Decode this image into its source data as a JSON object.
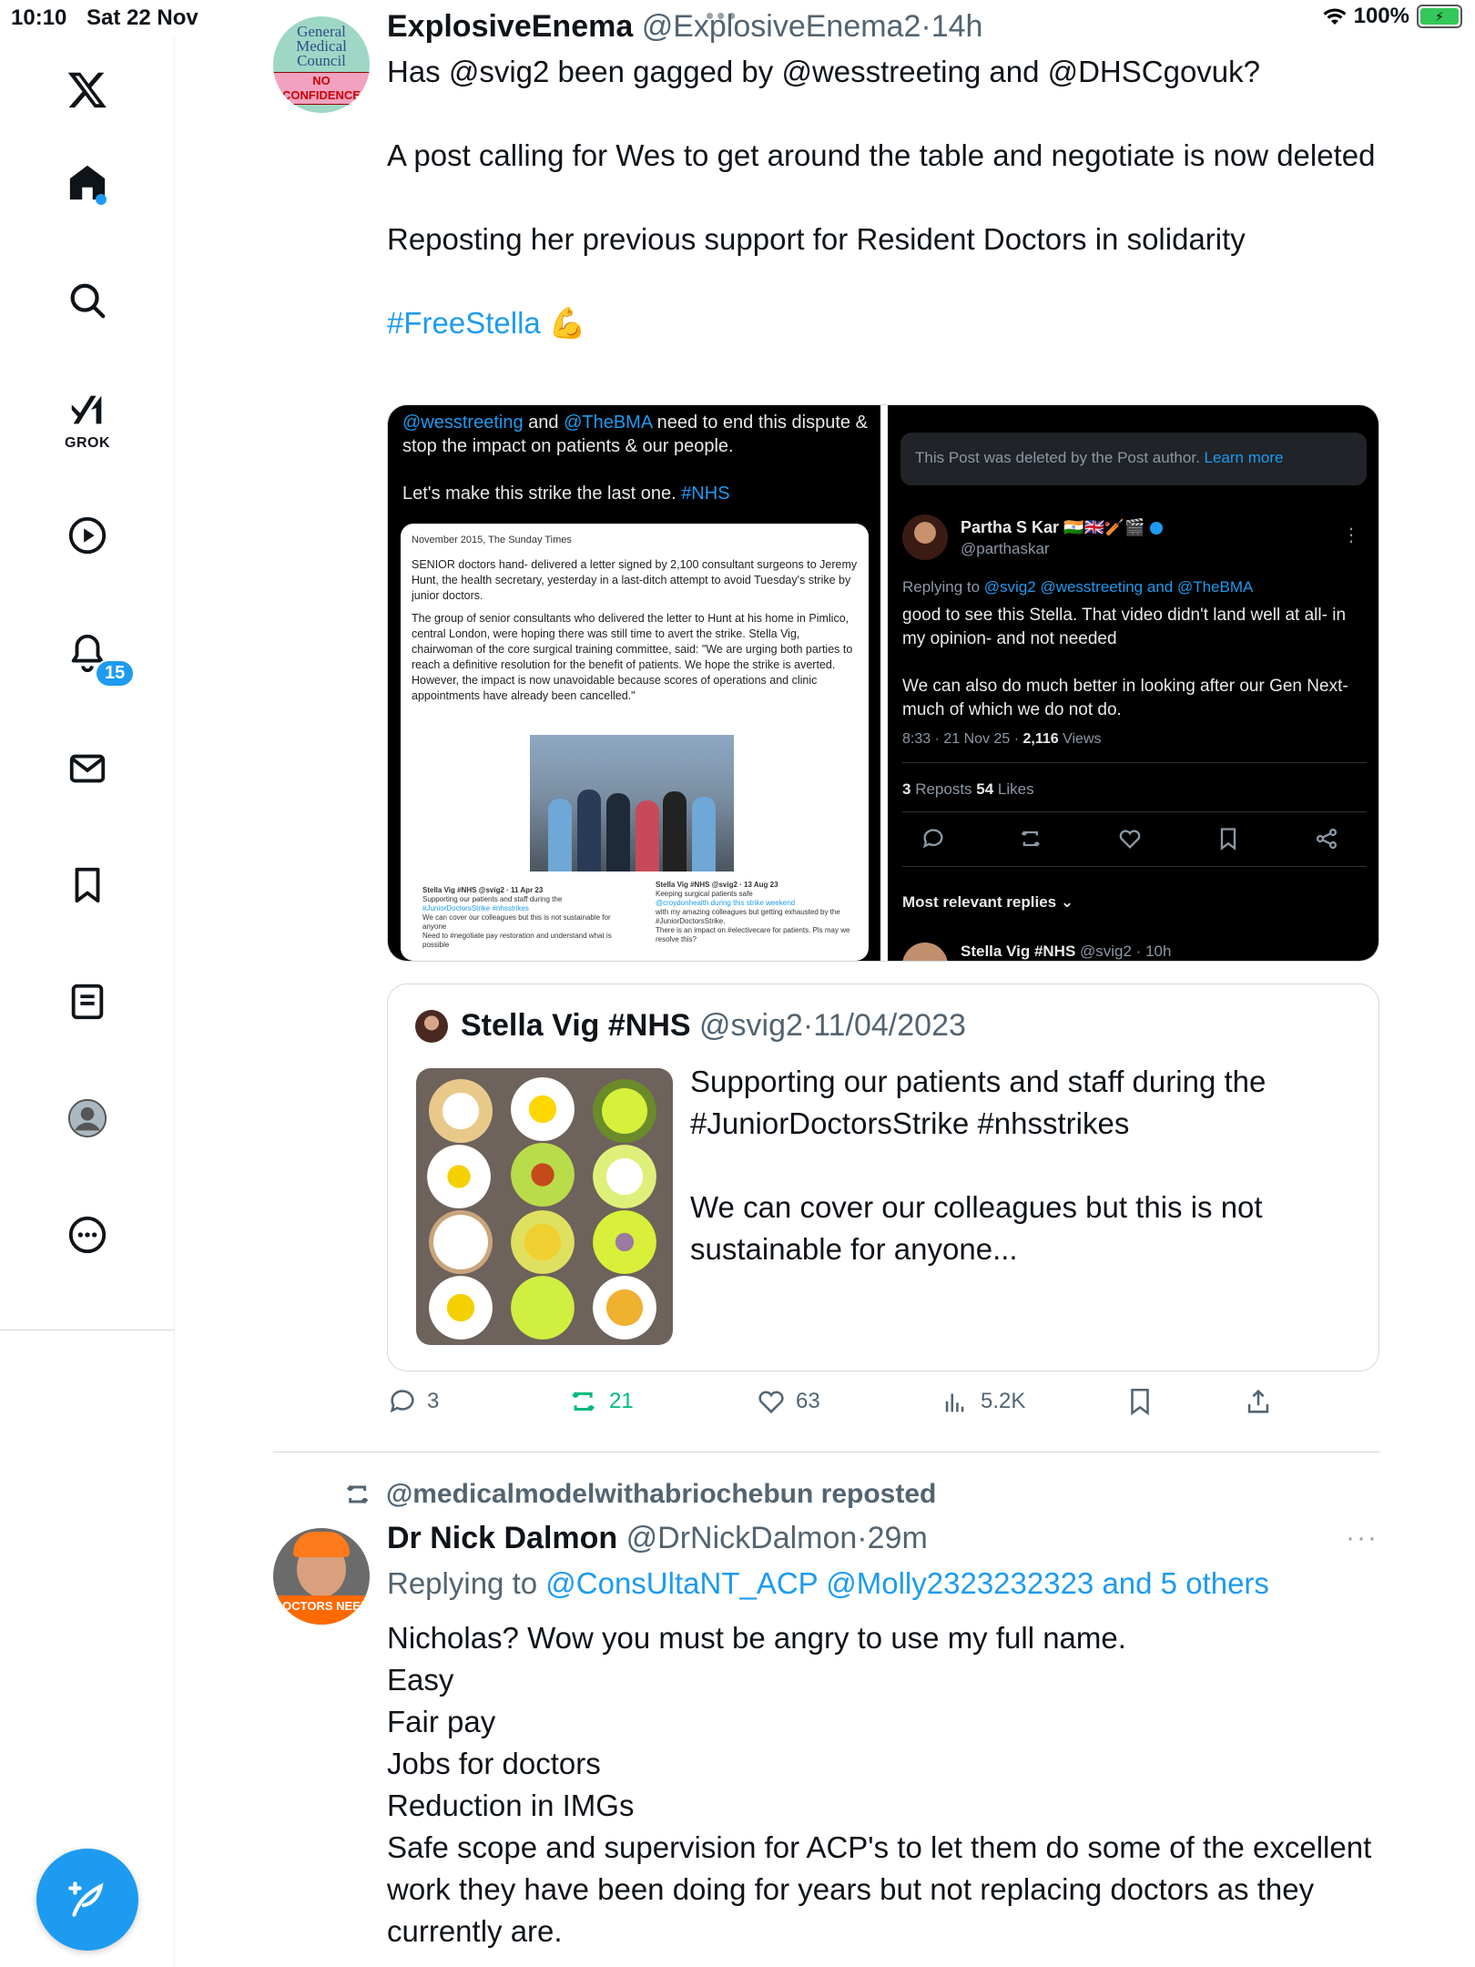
{
  "status_bar": {
    "time": "10:10",
    "date": "Sat 22 Nov",
    "battery": "100%"
  },
  "sidebar": {
    "items": [
      {
        "name": "x-logo-icon"
      },
      {
        "name": "home-icon"
      },
      {
        "name": "search-icon"
      },
      {
        "name": "grok-icon",
        "label": "GROK"
      },
      {
        "name": "video-icon"
      },
      {
        "name": "notifications-icon",
        "badge": "15"
      },
      {
        "name": "messages-icon"
      },
      {
        "name": "bookmarks-icon"
      },
      {
        "name": "lists-icon"
      },
      {
        "name": "profile-icon"
      },
      {
        "name": "more-icon"
      }
    ],
    "compose_icon": "compose-icon",
    "accent": "#1d9bf0"
  },
  "tweet1": {
    "avatar_text": [
      "General",
      "Medical",
      "Council"
    ],
    "avatar_badge": "NO CONFIDENCE",
    "name": "ExplosiveEnema",
    "handle": "@ExplosiveEnema2",
    "sep": "·",
    "time": "14h",
    "body": "Has @svig2 been gagged by @wesstreeting and @DHSCgovuk?\n\nA post calling for Wes to get around the table and negotiate is now deleted\n\nReposting her previous support for Resident Doctors in solidarity\n\n",
    "hashtag": "#FreeStella 💪",
    "media_left": {
      "line1_a": "@wesstreeting",
      "line1_b": " and ",
      "line1_c": "@TheBMA",
      "line1_d": "  need to end this dispute & stop the impact on patients & our people.",
      "line2_a": "Let's make this strike the last one. ",
      "line2_b": "#NHS",
      "article_source": "November 2015, The Sunday Times",
      "article_p1": "SENIOR doctors hand- delivered a letter signed by 2,100 consultant surgeons to Jeremy Hunt, the health secretary, yesterday in a last-ditch attempt to avoid Tuesday's strike by junior doctors.",
      "article_p2": "The group of senior consultants who delivered the letter to Hunt at his home in Pimlico, central London, were hoping there was still time to avert the strike. Stella Vig, chairwoman of the core surgical training committee, said: \"We are urging both parties to reach a definitive resolution for the benefit of patients. We hope the strike is averted. However, the impact is now unavoidable because scores of operations and clinic appointments have already been cancelled.\"",
      "mini1_head": "Stella Vig #NHS @svig2 · 11 Apr 23",
      "mini1_l1": "Supporting our patients and staff during the",
      "mini1_l2": "#JuniorDoctorsStrike #nhsstrikes",
      "mini1_l3": "We can cover our colleagues but this is not sustainable for anyone",
      "mini1_l4": "Need to #negotiate pay restoration and understand what is possible",
      "mini2_head": "Stella Vig #NHS @svig2 · 13 Aug 23",
      "mini2_l1": "Keeping surgical patients safe",
      "mini2_l2": "@croydonhealth during this strike weekend",
      "mini2_l3": "with my amazing colleagues but getting exhausted by the #JuniorDoctorsStrike.",
      "mini2_l4": "There is an impact on #electivecare for patients. Pls may we resolve this?"
    },
    "media_right": {
      "deleted_text": "This Post was deleted by the Post author. ",
      "learn_more": "Learn more",
      "name": "Partha S Kar 🇮🇳🇬🇧🏏🎬",
      "handle": "@parthaskar",
      "replying_a": "Replying to ",
      "replying_b": "@svig2 @wesstreeting and @TheBMA",
      "body": "good to see this Stella. That video didn't land well at all- in my opinion- and not needed\n\nWe can also do much better in looking after our Gen Next- much of which we do not do.",
      "meta_time": "8:33 · 21 Nov 25 · ",
      "meta_views": "2,116",
      "meta_views_label": " Views",
      "reposts": "3",
      "reposts_label": " Reposts   ",
      "likes": "54",
      "likes_label": " Likes",
      "relevant": "Most relevant replies  ⌄",
      "stella_name": "Stella Vig #NHS ",
      "stella_meta": "@svig2 · 10h"
    }
  },
  "quote": {
    "name": "Stella Vig #NHS",
    "handle": "@svig2",
    "sep": "·",
    "time": "11/04/2023",
    "body": "Supporting our patients and staff during the #JuniorDoctorsStrike #nhsstrikes\n\nWe can cover our colleagues but this is not sustainable for anyone..."
  },
  "actions": {
    "replies": "3",
    "reposts": "21",
    "likes": "63",
    "views": "5.2K"
  },
  "tweet2": {
    "reposted_by": "@medicalmodelwithabriochebun reposted",
    "avatar_sign": "DOCTORS NEED",
    "name": "Dr Nick Dalmon",
    "handle": "@DrNickDalmon",
    "sep": "·",
    "time": "29m",
    "more": "···",
    "replying_prefix": "Replying to ",
    "replying_to": "@ConsUltaNT_ACP @Molly2323232323 and 5 others",
    "body": "Nicholas? Wow you must be angry to use my full name.\nEasy\nFair pay\nJobs for doctors\nReduction in IMGs\nSafe scope and supervision for ACP's to let them do some of the excellent work they have been doing for years but not replacing doctors as they currently are."
  }
}
